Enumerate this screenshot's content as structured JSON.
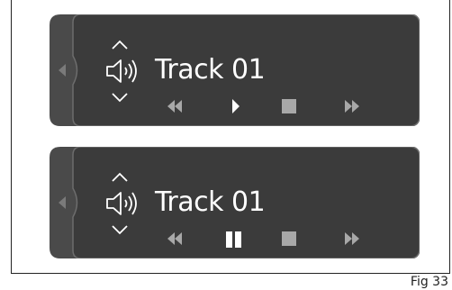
{
  "panels": [
    {
      "track_title": "Track 01",
      "play_state": "paused",
      "play_icon": "play-icon"
    },
    {
      "track_title": "Track 01",
      "play_state": "playing",
      "play_icon": "pause-icon"
    }
  ],
  "icons": [
    "volume-up-icon",
    "volume-down-icon",
    "speaker-icon",
    "rewind-icon",
    "stop-icon",
    "fast-forward-icon",
    "back-chevron-icon"
  ],
  "colors": {
    "panel": "#3b3b3b",
    "panel_back": "#4a4a4a",
    "foreground": "#ffffff",
    "muted": "#a8a8a8"
  },
  "caption": "Fig 33"
}
